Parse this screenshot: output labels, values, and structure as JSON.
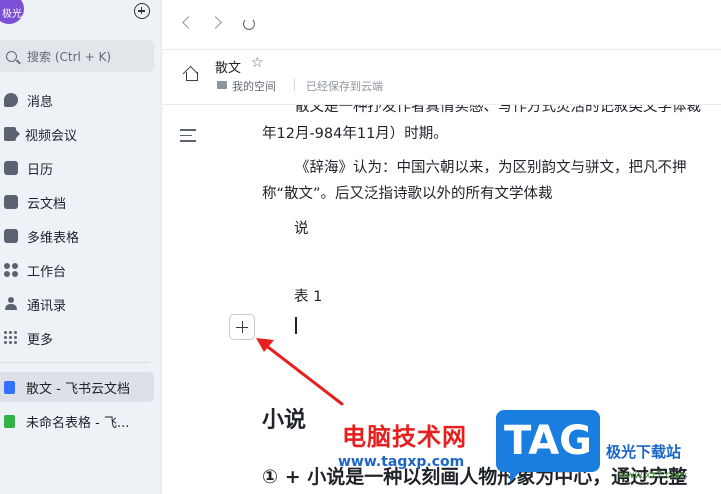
{
  "sidebar": {
    "avatar_text": "极光",
    "search_placeholder": "搜索 (Ctrl + K)",
    "items": [
      {
        "label": "消息",
        "icon": "message-icon"
      },
      {
        "label": "视频会议",
        "icon": "video-icon"
      },
      {
        "label": "日历",
        "icon": "calendar-icon"
      },
      {
        "label": "云文档",
        "icon": "cloud-doc-icon"
      },
      {
        "label": "多维表格",
        "icon": "base-icon"
      },
      {
        "label": "工作台",
        "icon": "workbench-icon"
      },
      {
        "label": "通讯录",
        "icon": "contacts-icon"
      },
      {
        "label": "更多",
        "icon": "more-icon"
      }
    ],
    "open_docs": [
      {
        "label": "散文 - 飞书云文档",
        "color": "#3370ff"
      },
      {
        "label": "未命名表格 - 飞...",
        "color": "#34b244"
      }
    ]
  },
  "header": {
    "title": "散文",
    "location": "我的空间",
    "save_status": "已经保存到云端"
  },
  "document": {
    "line1": "散文是一种抒发作者真情实感、写作方式灵活的记叙类文学体裁",
    "line2": "年12月-984年11月）时期。",
    "line3": "《辞海》认为：中国六朝以来，为区别韵文与骈文，把凡不押",
    "line4": "称“散文”。后又泛指诗歌以外的所有文学体裁",
    "line5": "说",
    "line6": "表 1",
    "heading": "小说",
    "subheading": "① + 小说是一种以刻画人物形象为中心，通过完整"
  },
  "watermark": {
    "brand": "电脑技术网",
    "url": "www.tagxp.com",
    "badge": "TAG",
    "site": "极光下载站",
    "site_url": "www.xz7.com"
  },
  "colors": {
    "accent_red": "#e5201f",
    "badge_blue": "#1a7de0"
  }
}
